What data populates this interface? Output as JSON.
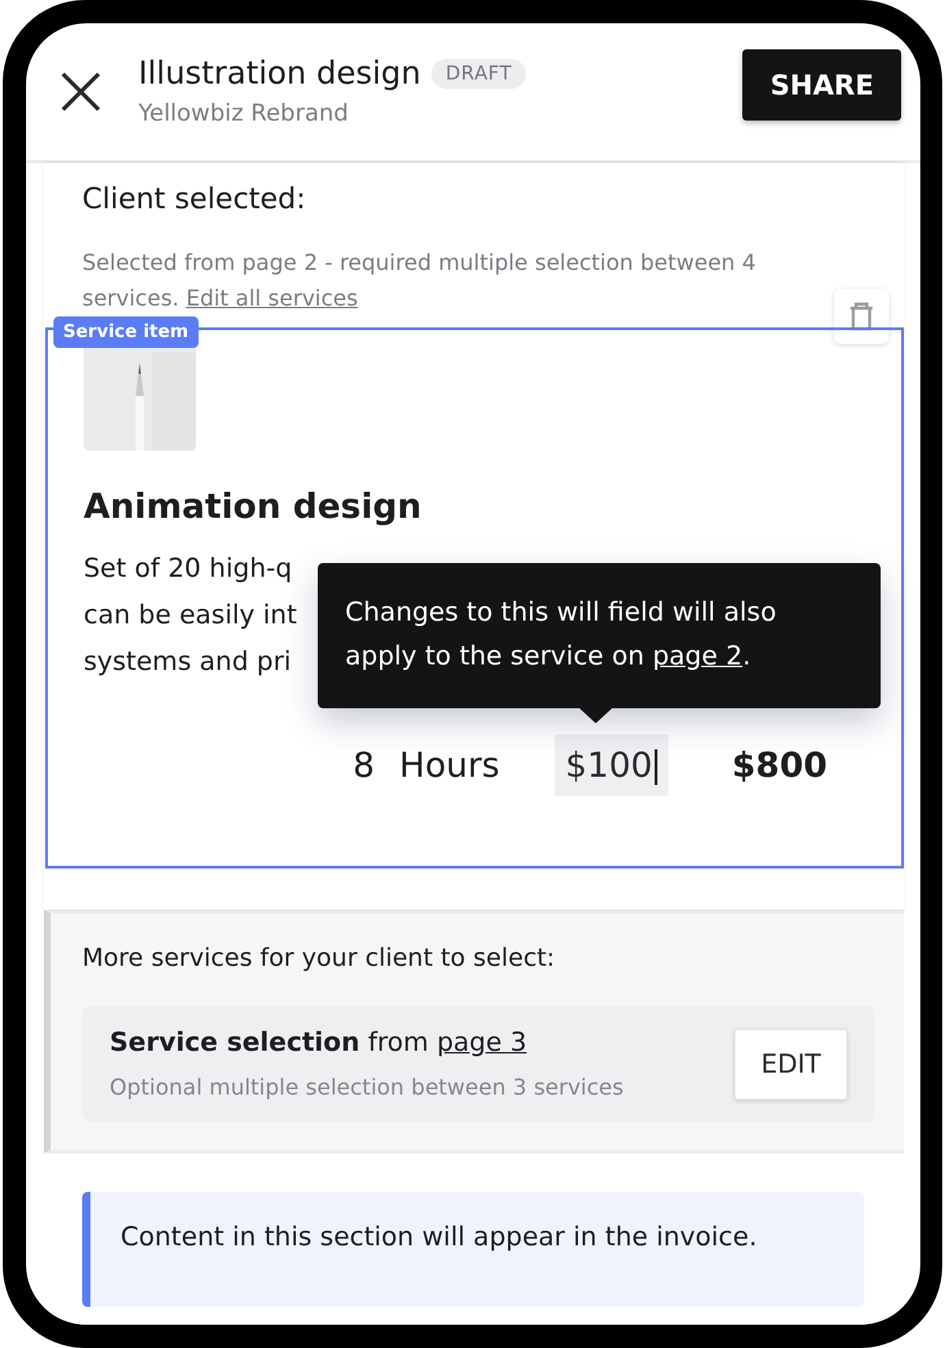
{
  "header": {
    "title": "Illustration design",
    "badge": "DRAFT",
    "subtitle": "Yellowbiz Rebrand",
    "share_button": "SHARE"
  },
  "client_section": {
    "heading": "Client selected:",
    "note": "Selected from page 2 - required multiple selection between 4 services.",
    "note_link": "Edit all services",
    "item_label": "Service item",
    "service": {
      "title": "Animation design",
      "description_lines": [
        "Set of 20 high-q",
        "can be easily int",
        "systems and pri"
      ],
      "quantity": "8",
      "unit": "Hours",
      "rate": "$100",
      "total": "$800"
    },
    "tooltip": {
      "text": "Changes to this will field will also apply to the service on ",
      "link": "page 2",
      "end": "."
    }
  },
  "more_section": {
    "heading": "More services for your client to select:",
    "card": {
      "title": "Service selection",
      "from": "from",
      "link": "page 3",
      "subtitle": "Optional multiple selection between 3 services",
      "button": "EDIT"
    }
  },
  "callout": {
    "text": "Content in this section will appear in the invoice."
  }
}
